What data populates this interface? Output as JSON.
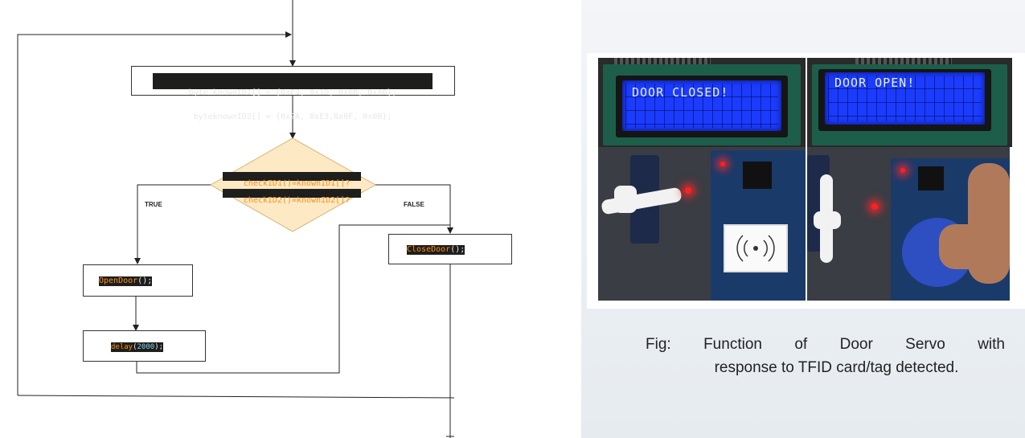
{
  "flowchart": {
    "init_box": {
      "line1": "byte knownID1[] = {0xF3, 0x1D, 0x6B, 0xA6};",
      "line2": "byteknownID2[] = {0x2A, 0xE3,0x0F, 0x0B};"
    },
    "decision": {
      "line1": "checkID1()=knownID1[]?",
      "line2": "checkID2()=knownID2[]?"
    },
    "true_label": "TRUE",
    "false_label": "FALSE",
    "open_box": {
      "fn": "OpenDoor",
      "suffix": "();"
    },
    "delay_box": {
      "fn": "delay",
      "open": "(",
      "arg": "2000",
      "close": ");"
    },
    "close_box": {
      "fn": "CloseDoor",
      "suffix": "();"
    }
  },
  "photos": {
    "lcd_left_text": "DOOR CLOSED!",
    "lcd_right_text": "DOOR OPEN!"
  },
  "caption": {
    "words": [
      "Fig:",
      "Function",
      "of",
      "Door",
      "Servo",
      "with"
    ],
    "line2": "response to TFID card/tag detected."
  },
  "colors": {
    "decision_fill": "#fde9c4",
    "decision_stroke": "#d4b577",
    "code_bg": "#1e1f1c",
    "code_fn": "#ff8c1a",
    "lcd_blue": "#1b3cff"
  }
}
